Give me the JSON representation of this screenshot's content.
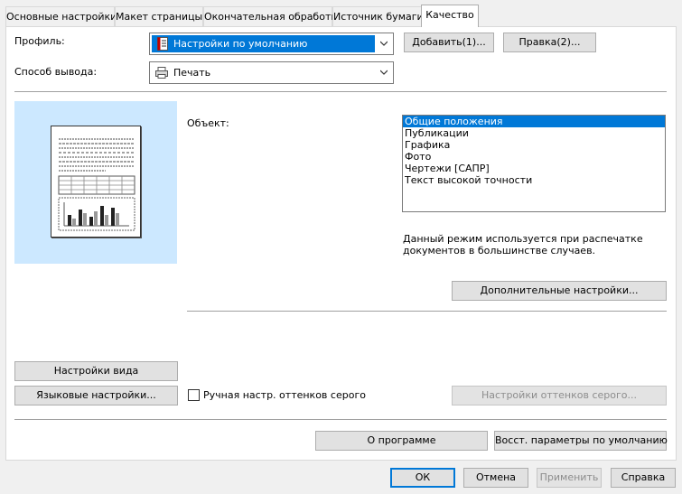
{
  "tabs": [
    {
      "label": "Основные настройки"
    },
    {
      "label": "Макет страницы"
    },
    {
      "label": "Окончательная обработка"
    },
    {
      "label": "Источник бумаги"
    },
    {
      "label": "Качество"
    }
  ],
  "profile": {
    "label": "Профиль:",
    "value": "Настройки по умолчанию",
    "add_button": "Добавить(1)...",
    "edit_button": "Правка(2)..."
  },
  "output": {
    "label": "Способ вывода:",
    "value": "Печать"
  },
  "object": {
    "label": "Объект:",
    "options": [
      {
        "label": "Общие положения"
      },
      {
        "label": "Публикации"
      },
      {
        "label": "Графика"
      },
      {
        "label": "Фото"
      },
      {
        "label": "Чертежи [САПР]"
      },
      {
        "label": "Текст высокой точности"
      }
    ],
    "selected": "Общие положения",
    "description_line1": "Данный режим используется при распечатке",
    "description_line2": "документов в большинстве случаев.",
    "advanced_button": "Дополнительные настройки..."
  },
  "left_buttons": {
    "view_settings": "Настройки вида",
    "language_settings": "Языковые настройки..."
  },
  "grayscale": {
    "checkbox_label": "Ручная настр. оттенков серого",
    "checked": false,
    "settings_button": "Настройки оттенков серого..."
  },
  "bottom_row": {
    "about": "О программе",
    "restore": "Восст. параметры по умолчанию"
  },
  "dialog_buttons": {
    "ok": "ОК",
    "cancel": "Отмена",
    "apply": "Применить",
    "help": "Справка"
  },
  "colors": {
    "accent": "#0078d7",
    "preview_bg": "#cce8ff"
  }
}
